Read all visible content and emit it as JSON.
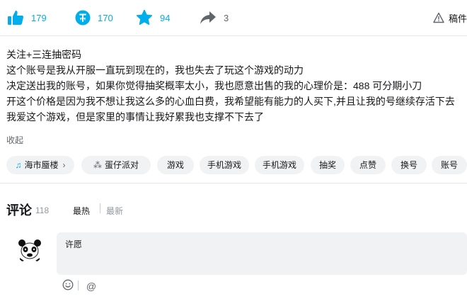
{
  "toolbar": {
    "like_count": "179",
    "coin_count": "170",
    "favorite_count": "94",
    "share_count": "3",
    "report_label": "稿件",
    "accent_color": "#00aeec"
  },
  "description": {
    "lines": [
      "关注+三连抽密码",
      "这个账号是我从开服一直玩到现在的，我也失去了玩这个游戏的动力",
      "决定送出我的账号，如果你觉得抽奖概率太小，我也愿意出售的我的心理价是：488 可分期小刀",
      "开这个价格是因为我不想让我这么多的心血白费，我希望能有能力的人买下,并且让我的号继续存活下去",
      "我爱这个游戏，但是家里的事情让我好累我也支撑不下去了"
    ],
    "collapse_label": "收起"
  },
  "tags": [
    {
      "label": "海市蜃楼",
      "icon": "music-note-icon",
      "arrow": "›"
    },
    {
      "label": "蛋仔派对",
      "icon": "dots-cluster-icon"
    },
    {
      "label": "游戏"
    },
    {
      "label": "手机游戏"
    },
    {
      "label": "手机游戏"
    },
    {
      "label": "抽奖"
    },
    {
      "label": "点赞"
    },
    {
      "label": "换号"
    },
    {
      "label": "账号"
    }
  ],
  "comments": {
    "title": "评论",
    "count": "118",
    "sort_hot": "最热",
    "sort_new": "最新",
    "reply_placeholder": "许愿"
  }
}
